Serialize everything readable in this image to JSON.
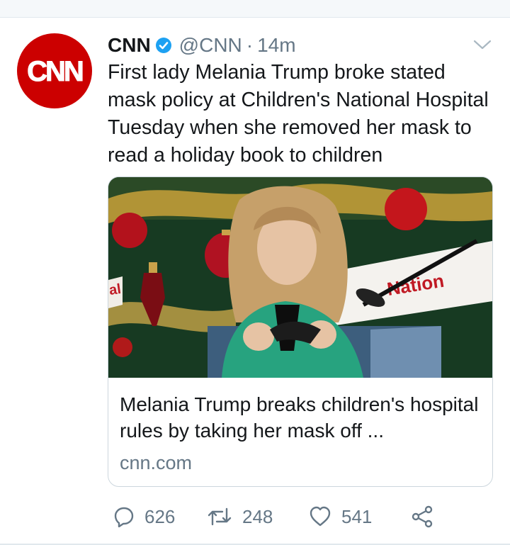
{
  "tweet": {
    "author_name": "CNN",
    "handle": "@CNN",
    "separator": "·",
    "time": "14m",
    "text": "First lady Melania Trump broke stated mask policy at Children's National Hospital Tuesday when she removed her mask to read a holiday book to children",
    "avatar_logo": "CNN",
    "card": {
      "title": "Melania Trump breaks children's hospital rules by taking her mask off ...",
      "domain": "cnn.com",
      "banner_text": "Nation",
      "banner_fragment": "al"
    },
    "actions": {
      "reply_count": "626",
      "retweet_count": "248",
      "like_count": "541"
    }
  },
  "colors": {
    "brand_red": "#cc0000",
    "verified_blue": "#1da1f2",
    "secondary_text": "#657786",
    "border": "#ccd6dd"
  },
  "icons": [
    "verified-badge-icon",
    "chevron-down-icon",
    "reply-icon",
    "retweet-icon",
    "like-icon",
    "share-icon"
  ]
}
